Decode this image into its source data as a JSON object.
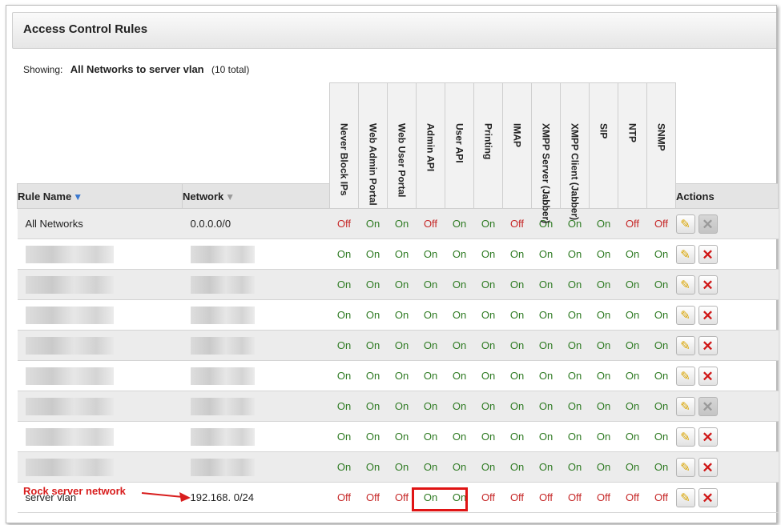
{
  "panel": {
    "title": "Access Control Rules"
  },
  "showing": {
    "label": "Showing:",
    "network": "All Networks to server vlan",
    "total": "(10 total)"
  },
  "columns": {
    "rule_name": "Rule Name",
    "network": "Network",
    "actions": "Actions",
    "services": [
      "Never Block IPs",
      "Web Admin Portal",
      "Web User Portal",
      "Admin API",
      "User API",
      "Printing",
      "IMAP",
      "XMPP Server (Jabber)",
      "XMPP Client (Jabber)",
      "SIP",
      "NTP",
      "SNMP"
    ]
  },
  "rows": [
    {
      "name": "All Networks",
      "network": "0.0.0.0/0",
      "states": [
        "Off",
        "On",
        "On",
        "Off",
        "On",
        "On",
        "Off",
        "On",
        "On",
        "On",
        "Off",
        "Off"
      ],
      "delete_enabled": false
    },
    {
      "name": "",
      "network": "",
      "states": [
        "On",
        "On",
        "On",
        "On",
        "On",
        "On",
        "On",
        "On",
        "On",
        "On",
        "On",
        "On"
      ],
      "delete_enabled": true
    },
    {
      "name": "",
      "network": "",
      "states": [
        "On",
        "On",
        "On",
        "On",
        "On",
        "On",
        "On",
        "On",
        "On",
        "On",
        "On",
        "On"
      ],
      "delete_enabled": true
    },
    {
      "name": "",
      "network": "",
      "states": [
        "On",
        "On",
        "On",
        "On",
        "On",
        "On",
        "On",
        "On",
        "On",
        "On",
        "On",
        "On"
      ],
      "delete_enabled": true
    },
    {
      "name": "",
      "network": "",
      "states": [
        "On",
        "On",
        "On",
        "On",
        "On",
        "On",
        "On",
        "On",
        "On",
        "On",
        "On",
        "On"
      ],
      "delete_enabled": true
    },
    {
      "name": "",
      "network": "",
      "states": [
        "On",
        "On",
        "On",
        "On",
        "On",
        "On",
        "On",
        "On",
        "On",
        "On",
        "On",
        "On"
      ],
      "delete_enabled": true
    },
    {
      "name": "",
      "network": "",
      "states": [
        "On",
        "On",
        "On",
        "On",
        "On",
        "On",
        "On",
        "On",
        "On",
        "On",
        "On",
        "On"
      ],
      "delete_enabled": false
    },
    {
      "name": "",
      "network": "",
      "states": [
        "On",
        "On",
        "On",
        "On",
        "On",
        "On",
        "On",
        "On",
        "On",
        "On",
        "On",
        "On"
      ],
      "delete_enabled": true
    },
    {
      "name": "",
      "network": "",
      "states": [
        "On",
        "On",
        "On",
        "On",
        "On",
        "On",
        "On",
        "On",
        "On",
        "On",
        "On",
        "On"
      ],
      "delete_enabled": true
    },
    {
      "name": "server vlan",
      "network": "192.168.   0/24",
      "states": [
        "Off",
        "Off",
        "Off",
        "On",
        "On",
        "Off",
        "Off",
        "Off",
        "Off",
        "Off",
        "Off",
        "Off"
      ],
      "delete_enabled": true
    }
  ],
  "annotation": {
    "label": "Rock server network",
    "color": "#d81e1e"
  },
  "icons": {
    "sort_asc": "sort-down-blue-icon",
    "sort": "sort-down-grey-icon",
    "edit": "pencil-icon",
    "delete": "delete-x-icon"
  },
  "colors": {
    "on": "#2e7a22",
    "off": "#c62828",
    "highlight": "#e01414"
  }
}
